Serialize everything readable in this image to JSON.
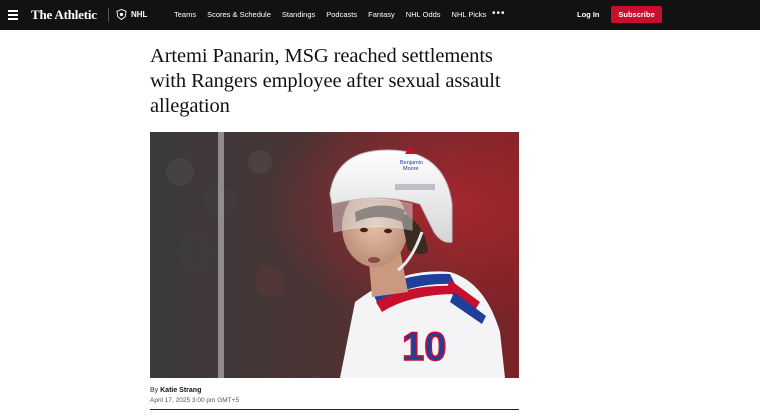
{
  "nav": {
    "brand": "The Athletic",
    "league": "NHL",
    "links": [
      "Teams",
      "Scores & Schedule",
      "Standings",
      "Podcasts",
      "Fantasy",
      "NHL Odds",
      "NHL Picks"
    ],
    "more": "•••",
    "login": "Log In",
    "subscribe": "Subscribe"
  },
  "article": {
    "headline": "Artemi Panarin, MSG reached settlements with Rangers employee after sexual assault allegation",
    "byline_prefix": "By",
    "author": "Katie Strang",
    "date": "April 17, 2025 3:00 pm GMT+5",
    "image": {
      "jersey_number": "10",
      "helmet_text_1": "Benjamin",
      "helmet_text_2": "Moore"
    }
  },
  "colors": {
    "nav_bg": "#121212",
    "subscribe_bg": "#c8102e",
    "text": "#121212"
  },
  "icons": [
    "hamburger-icon",
    "nhl-logo-icon",
    "more-icon"
  ]
}
